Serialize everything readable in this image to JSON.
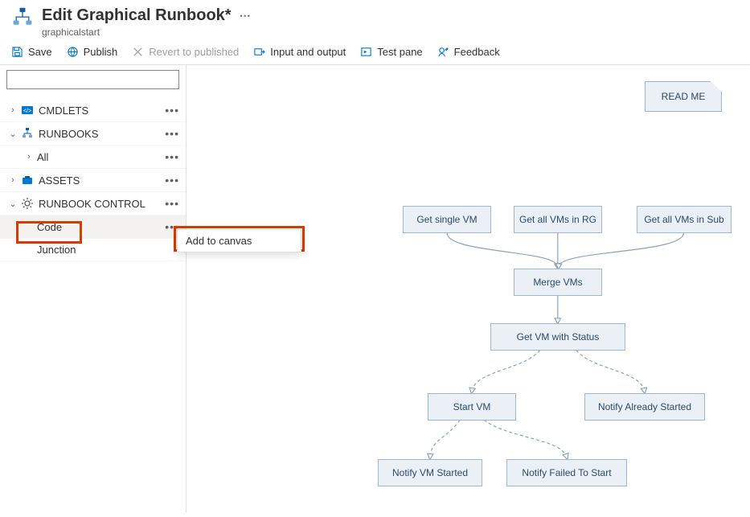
{
  "header": {
    "title": "Edit Graphical Runbook*",
    "subtitle": "graphicalstart"
  },
  "toolbar": {
    "save": "Save",
    "publish": "Publish",
    "revert": "Revert to published",
    "input_output": "Input and output",
    "test_pane": "Test pane",
    "feedback": "Feedback"
  },
  "sidebar": {
    "search_placeholder": "",
    "items": {
      "cmdlets": "CMDLETS",
      "runbooks": "RUNBOOKS",
      "all": "All",
      "assets": "ASSETS",
      "runbook_control": "RUNBOOK CONTROL",
      "code": "Code",
      "junction": "Junction"
    }
  },
  "context_menu": {
    "add_to_canvas": "Add to canvas"
  },
  "canvas": {
    "nodes": {
      "readme": "READ ME",
      "get_single_vm": "Get single VM",
      "get_all_vms_rg": "Get all VMs in RG",
      "get_all_vms_sub": "Get all VMs in Sub",
      "merge_vms": "Merge VMs",
      "get_vm_status": "Get VM with Status",
      "start_vm": "Start VM",
      "notify_already": "Notify Already Started",
      "notify_started": "Notify VM Started",
      "notify_failed": "Notify Failed To Start"
    }
  }
}
